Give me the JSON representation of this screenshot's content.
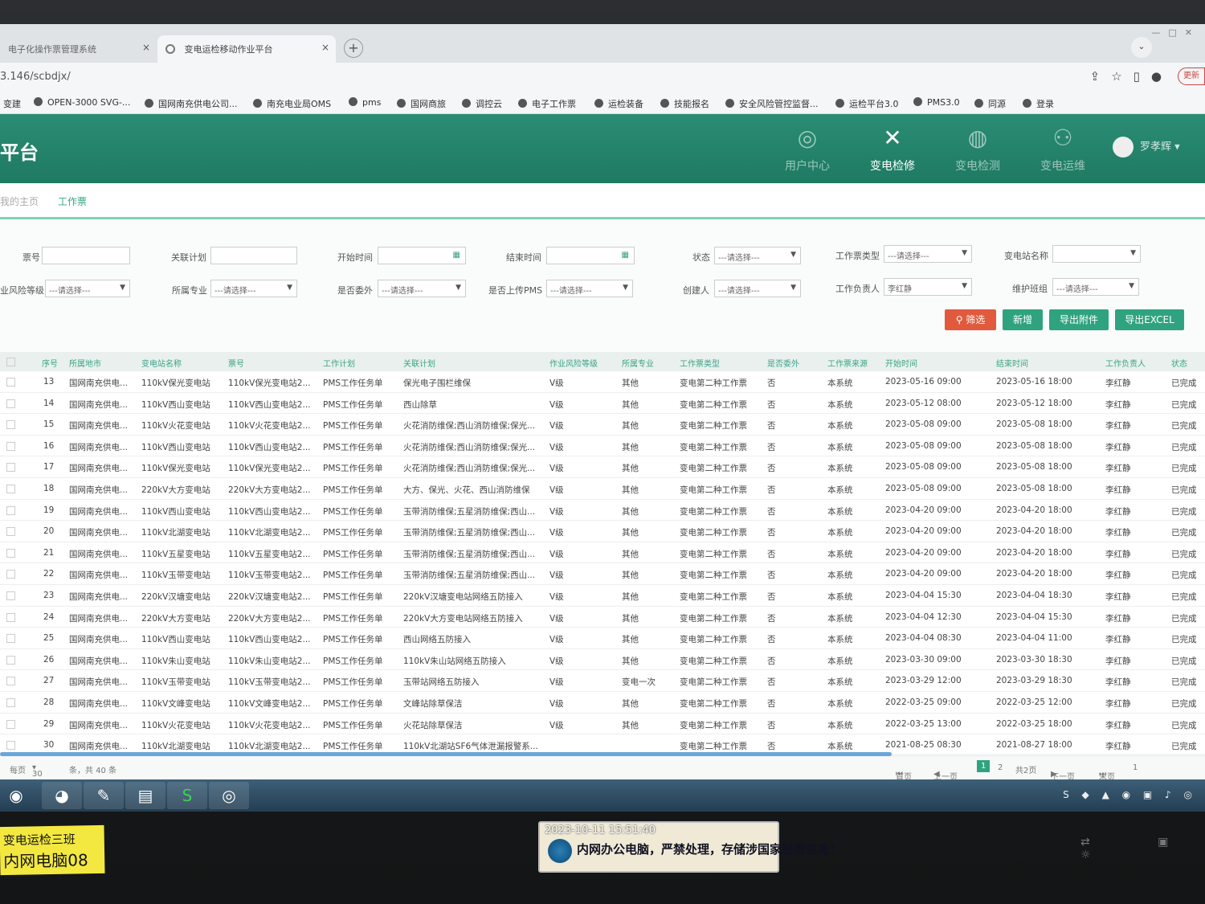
{
  "browser": {
    "tabs": [
      {
        "title": "电子化操作票管理系统",
        "close": "×"
      },
      {
        "title": "变电运检移动作业平台",
        "close": "×"
      }
    ],
    "new_tab": "+",
    "url": "3.146/scbdjx/",
    "update_label": "更新",
    "bookmarks": [
      "变建",
      "OPEN-3000 SVG-...",
      "国网南充供电公司...",
      "南充电业局OMS",
      "pms",
      "国网商旅",
      "调控云",
      "电子工作票",
      "运检装备",
      "技能报名",
      "安全风险管控监督...",
      "运检平台3.0",
      "PMS3.0",
      "同源",
      "登录"
    ]
  },
  "app": {
    "brand": "平台",
    "nav": [
      {
        "label": "用户中心",
        "icon": "user-circle-icon"
      },
      {
        "label": "变电检修",
        "icon": "tools-icon"
      },
      {
        "label": "变电检测",
        "icon": "pulse-icon"
      },
      {
        "label": "变电运维",
        "icon": "people-icon"
      }
    ],
    "user": "罗孝辉",
    "page_tabs": {
      "home": "我的主页",
      "current": "工作票"
    }
  },
  "filters": {
    "labels": {
      "ticket_no": "票号",
      "plan": "关联计划",
      "start": "开始时间",
      "end": "结束时间",
      "status": "状态",
      "ticket_type": "工作票类型",
      "station": "变电站名称",
      "risk": "业风险等级",
      "major": "所属专业",
      "outsource": "是否委外",
      "pms": "是否上传PMS",
      "creator": "创建人",
      "leader": "工作负责人",
      "team": "维护班组"
    },
    "placeholder": "---请选择---",
    "leader_value": "李红静",
    "buttons": {
      "filter": "筛选",
      "add": "新增",
      "export_attach": "导出附件",
      "export_excel": "导出EXCEL"
    }
  },
  "table": {
    "headers": [
      "序号",
      "所属地市",
      "变电站名称",
      "票号",
      "工作计划",
      "关联计划",
      "作业风险等级",
      "所属专业",
      "工作票类型",
      "是否委外",
      "工作票来源",
      "开始时间",
      "结束时间",
      "工作负责人",
      "状态"
    ],
    "rows": [
      [
        "13",
        "国网南充供电...",
        "110kV保光变电站",
        "110kV保光变电站2...",
        "PMS工作任务单",
        "保光电子围栏维保",
        "V级",
        "其他",
        "变电第二种工作票",
        "否",
        "本系统",
        "2023-05-16 09:00",
        "2023-05-16 18:00",
        "李红静",
        "已完成"
      ],
      [
        "14",
        "国网南充供电...",
        "110kV西山变电站",
        "110kV西山变电站2...",
        "PMS工作任务单",
        "西山除草",
        "V级",
        "其他",
        "变电第二种工作票",
        "否",
        "本系统",
        "2023-05-12 08:00",
        "2023-05-12 18:00",
        "李红静",
        "已完成"
      ],
      [
        "15",
        "国网南充供电...",
        "110kV火花变电站",
        "110kV火花变电站2...",
        "PMS工作任务单",
        "火花消防维保;西山消防维保;保光...",
        "V级",
        "其他",
        "变电第二种工作票",
        "否",
        "本系统",
        "2023-05-08 09:00",
        "2023-05-08 18:00",
        "李红静",
        "已完成"
      ],
      [
        "16",
        "国网南充供电...",
        "110kV西山变电站",
        "110kV西山变电站2...",
        "PMS工作任务单",
        "火花消防维保;西山消防维保;保光...",
        "V级",
        "其他",
        "变电第二种工作票",
        "否",
        "本系统",
        "2023-05-08 09:00",
        "2023-05-08 18:00",
        "李红静",
        "已完成"
      ],
      [
        "17",
        "国网南充供电...",
        "110kV保光变电站",
        "110kV保光变电站2...",
        "PMS工作任务单",
        "火花消防维保;西山消防维保;保光...",
        "V级",
        "其他",
        "变电第二种工作票",
        "否",
        "本系统",
        "2023-05-08 09:00",
        "2023-05-08 18:00",
        "李红静",
        "已完成"
      ],
      [
        "18",
        "国网南充供电...",
        "220kV大方变电站",
        "220kV大方变电站2...",
        "PMS工作任务单",
        "大方、保光、火花、西山消防维保",
        "V级",
        "其他",
        "变电第二种工作票",
        "否",
        "本系统",
        "2023-05-08 09:00",
        "2023-05-08 18:00",
        "李红静",
        "已完成"
      ],
      [
        "19",
        "国网南充供电...",
        "110kV西山变电站",
        "110kV西山变电站2...",
        "PMS工作任务单",
        "玉带消防维保;五星消防维保;西山...",
        "V级",
        "其他",
        "变电第二种工作票",
        "否",
        "本系统",
        "2023-04-20 09:00",
        "2023-04-20 18:00",
        "李红静",
        "已完成"
      ],
      [
        "20",
        "国网南充供电...",
        "110kV北湖变电站",
        "110kV北湖变电站2...",
        "PMS工作任务单",
        "玉带消防维保;五星消防维保;西山...",
        "V级",
        "其他",
        "变电第二种工作票",
        "否",
        "本系统",
        "2023-04-20 09:00",
        "2023-04-20 18:00",
        "李红静",
        "已完成"
      ],
      [
        "21",
        "国网南充供电...",
        "110kV五星变电站",
        "110kV五星变电站2...",
        "PMS工作任务单",
        "玉带消防维保;五星消防维保;西山...",
        "V级",
        "其他",
        "变电第二种工作票",
        "否",
        "本系统",
        "2023-04-20 09:00",
        "2023-04-20 18:00",
        "李红静",
        "已完成"
      ],
      [
        "22",
        "国网南充供电...",
        "110kV玉带变电站",
        "110kV玉带变电站2...",
        "PMS工作任务单",
        "玉带消防维保;五星消防维保;西山...",
        "V级",
        "其他",
        "变电第二种工作票",
        "否",
        "本系统",
        "2023-04-20 09:00",
        "2023-04-20 18:00",
        "李红静",
        "已完成"
      ],
      [
        "23",
        "国网南充供电...",
        "220kV汉塘变电站",
        "220kV汉塘变电站2...",
        "PMS工作任务单",
        "220kV汉塘变电站网络五防接入",
        "V级",
        "其他",
        "变电第二种工作票",
        "否",
        "本系统",
        "2023-04-04 15:30",
        "2023-04-04 18:30",
        "李红静",
        "已完成"
      ],
      [
        "24",
        "国网南充供电...",
        "220kV大方变电站",
        "220kV大方变电站2...",
        "PMS工作任务单",
        "220kV大方变电站网络五防接入",
        "V级",
        "其他",
        "变电第二种工作票",
        "否",
        "本系统",
        "2023-04-04 12:30",
        "2023-04-04 15:30",
        "李红静",
        "已完成"
      ],
      [
        "25",
        "国网南充供电...",
        "110kV西山变电站",
        "110kV西山变电站2...",
        "PMS工作任务单",
        "西山网络五防接入",
        "V级",
        "其他",
        "变电第二种工作票",
        "否",
        "本系统",
        "2023-04-04 08:30",
        "2023-04-04 11:00",
        "李红静",
        "已完成"
      ],
      [
        "26",
        "国网南充供电...",
        "110kV朱山变电站",
        "110kV朱山变电站2...",
        "PMS工作任务单",
        "110kV朱山站网络五防接入",
        "V级",
        "其他",
        "变电第二种工作票",
        "否",
        "本系统",
        "2023-03-30 09:00",
        "2023-03-30 18:30",
        "李红静",
        "已完成"
      ],
      [
        "27",
        "国网南充供电...",
        "110kV玉带变电站",
        "110kV玉带变电站2...",
        "PMS工作任务单",
        "玉带站网络五防接入",
        "V级",
        "变电一次",
        "变电第二种工作票",
        "否",
        "本系统",
        "2023-03-29 12:00",
        "2023-03-29 18:30",
        "李红静",
        "已完成"
      ],
      [
        "28",
        "国网南充供电...",
        "110kV文峰变电站",
        "110kV文峰变电站2...",
        "PMS工作任务单",
        "文峰站除草保洁",
        "V级",
        "其他",
        "变电第二种工作票",
        "否",
        "本系统",
        "2022-03-25 09:00",
        "2022-03-25 12:00",
        "李红静",
        "已完成"
      ],
      [
        "29",
        "国网南充供电...",
        "110kV火花变电站",
        "110kV火花变电站2...",
        "PMS工作任务单",
        "火花站除草保洁",
        "V级",
        "其他",
        "变电第二种工作票",
        "否",
        "本系统",
        "2022-03-25 13:00",
        "2022-03-25 18:00",
        "李红静",
        "已完成"
      ],
      [
        "30",
        "国网南充供电...",
        "110kV北湖变电站",
        "110kV北湖变电站2...",
        "PMS工作任务单",
        "110kV北湖站SF6气体泄漏报警系...",
        "",
        "",
        "变电第二种工作票",
        "否",
        "本系统",
        "2021-08-25 08:30",
        "2021-08-27 18:00",
        "李红静",
        "已完成"
      ]
    ]
  },
  "pager": {
    "per_page_label": "每页",
    "per_page": "30",
    "total": "条，共 40 条",
    "first": "首页",
    "prev": "上一页",
    "current": "1",
    "page2": "2",
    "total_pages": "共2页",
    "next": "下一页",
    "last": "末页",
    "jump": "1"
  },
  "overlay": {
    "sticker_team": "变电运检三班",
    "sticker_pc": "内网电脑08",
    "timestamp": "2023-10-11 15:51:40",
    "warning": "内网办公电脑，严禁处理，存储涉国家秘密信息！"
  }
}
